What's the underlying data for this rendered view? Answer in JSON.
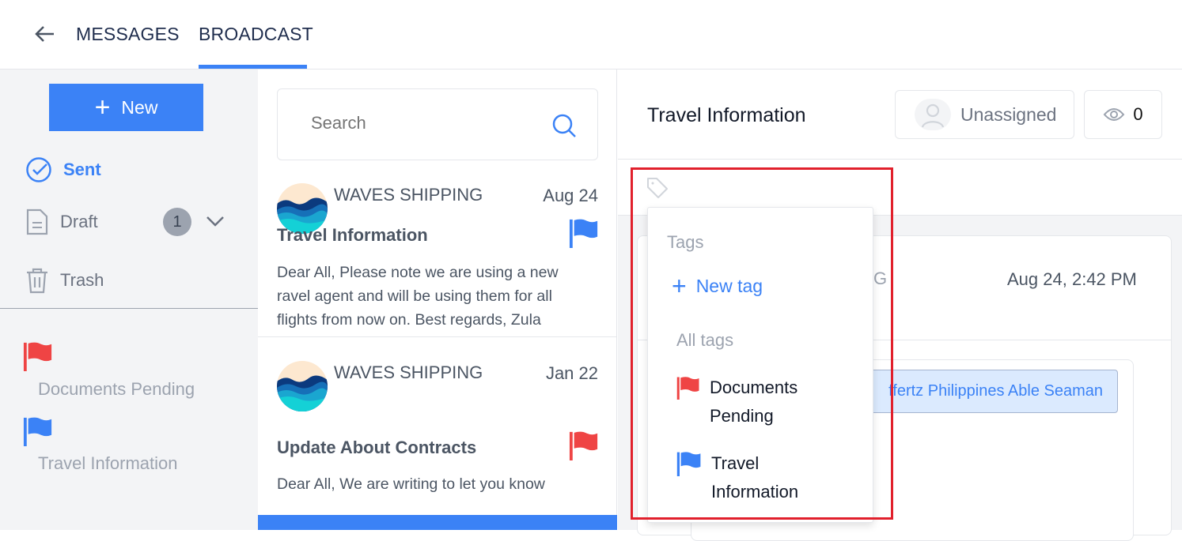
{
  "nav": {
    "back_icon": "arrow-left-icon",
    "tabs": [
      {
        "label": "MESSAGES",
        "active": false
      },
      {
        "label": "BROADCAST",
        "active": true
      }
    ],
    "accent": "#3b82f6"
  },
  "sidebar": {
    "new_label": "New",
    "items": [
      {
        "label": "Sent",
        "icon": "check-circle-icon",
        "active": true
      },
      {
        "label": "Draft",
        "icon": "document-icon",
        "badge": "1"
      },
      {
        "label": "Trash",
        "icon": "trash-icon"
      }
    ],
    "tags": [
      {
        "label": "Documents Pending",
        "color": "#ef4444"
      },
      {
        "label": "Travel Information",
        "color": "#3b82f6"
      }
    ]
  },
  "list": {
    "search_placeholder": "Search",
    "messages": [
      {
        "sender": "WAVES SHIPPING",
        "date": "Aug 24",
        "subject": "Travel Information",
        "preview": "Dear All, Please note we are using a new ravel agent and will be using them for all flights from now on. Best regards, Zula",
        "flag": "#3b82f6"
      },
      {
        "sender": "WAVES SHIPPING",
        "date": "Jan 22",
        "subject": "Update About Contracts",
        "preview": "Dear All, We are writing to let you know",
        "flag": "#ef4444"
      }
    ]
  },
  "detail": {
    "title": "Travel Information",
    "assignee": "Unassigned",
    "views": "0",
    "sender_partial": "G",
    "timestamp": "Aug 24, 2:42 PM",
    "recipient_chip": "ffertz Philippines Able Seaman"
  },
  "tag_dropdown": {
    "header": "Tags",
    "new_tag": "New tag",
    "all_tags": "All tags",
    "items": [
      {
        "label1": "Documents",
        "label2": "Pending",
        "color": "#ef4444"
      },
      {
        "label1": "Travel",
        "label2": "Information",
        "color": "#3b82f6"
      }
    ]
  }
}
